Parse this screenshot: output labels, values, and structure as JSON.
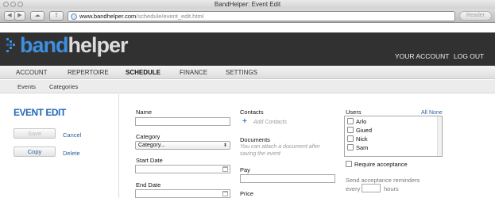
{
  "window": {
    "title": "BandHelper: Event Edit",
    "url_host": "www.bandhelper.com",
    "url_path": "/schedule/event_edit.html",
    "reader_label": "Reader"
  },
  "header": {
    "logo_band": "band",
    "logo_helper": "helper",
    "account_label": "YOUR ACCOUNT",
    "logout_label": "LOG OUT"
  },
  "nav": {
    "items": [
      "ACCOUNT",
      "REPERTOIRE",
      "SCHEDULE",
      "FINANCE",
      "SETTINGS"
    ],
    "active": "SCHEDULE"
  },
  "subnav": {
    "items": [
      "Events",
      "Categories"
    ]
  },
  "sidebar": {
    "title": "EVENT EDIT",
    "save_label": "Save",
    "cancel_label": "Cancel",
    "copy_label": "Copy",
    "delete_label": "Delete"
  },
  "form": {
    "name_label": "Name",
    "name_value": "",
    "category_label": "Category",
    "category_value": "Category...",
    "start_date_label": "Start Date",
    "end_date_label": "End Date",
    "contacts_label": "Contacts",
    "add_contacts_label": "Add Contacts",
    "documents_label": "Documents",
    "documents_note": "You can attach a document after saving the event",
    "pay_label": "Pay",
    "price_label": "Price",
    "users_label": "Users",
    "users_all": "All",
    "users_none": "None",
    "users": [
      {
        "name": "Arlo",
        "checked": false
      },
      {
        "name": "Giued",
        "checked": false
      },
      {
        "name": "Nick",
        "checked": false
      },
      {
        "name": "Sam",
        "checked": false
      }
    ],
    "require_acceptance_label": "Require acceptance",
    "reminders_label": "Send acceptance reminders",
    "every_label": "every",
    "hours_label": "hours"
  },
  "colors": {
    "brand_blue": "#3d8fe0",
    "header_bg": "#313131",
    "link_blue": "#2b5e9e"
  }
}
